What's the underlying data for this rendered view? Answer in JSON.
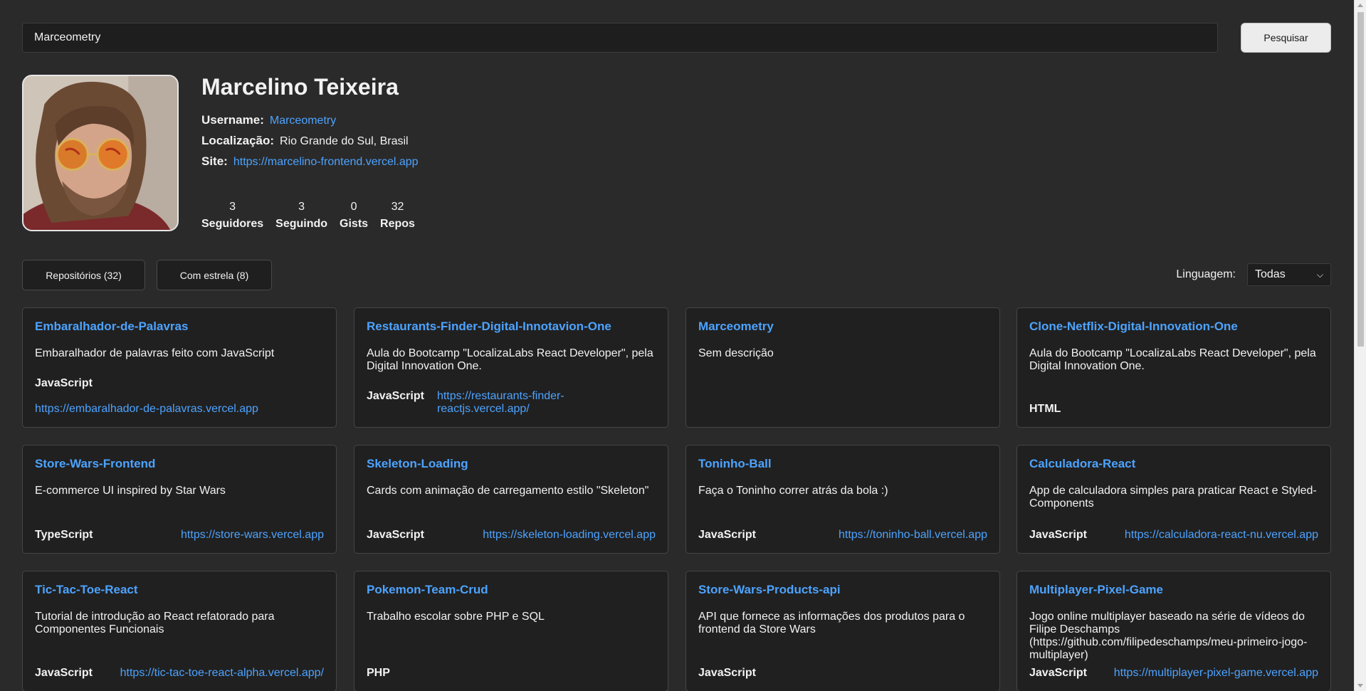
{
  "search": {
    "value": "Marceometry",
    "button_label": "Pesquisar"
  },
  "profile": {
    "name": "Marcelino Teixeira",
    "username_label": "Username:",
    "username": "Marceometry",
    "location_label": "Localização:",
    "location": "Rio Grande do Sul, Brasil",
    "site_label": "Site:",
    "site": "https://marcelino-frontend.vercel.app",
    "stats": [
      {
        "value": "3",
        "label": "Seguidores"
      },
      {
        "value": "3",
        "label": "Seguindo"
      },
      {
        "value": "0",
        "label": "Gists"
      },
      {
        "value": "32",
        "label": "Repos"
      }
    ]
  },
  "tabs": {
    "repos_label": "Repositórios (32)",
    "starred_label": "Com estrela (8)"
  },
  "filter": {
    "label": "Linguagem:",
    "selected": "Todas"
  },
  "repos": [
    {
      "title": "Embaralhador-de-Palavras",
      "desc": "Embaralhador de palavras feito com JavaScript",
      "lang": "JavaScript",
      "link": "https://embaralhador-de-palavras.vercel.app"
    },
    {
      "title": "Restaurants-Finder-Digital-Innotavion-One",
      "desc": "Aula do Bootcamp \"LocalizaLabs React Developer\", pela Digital Innovation One.",
      "lang": "JavaScript",
      "link": "https://restaurants-finder-reactjs.vercel.app/"
    },
    {
      "title": "Marceometry",
      "desc": "Sem descrição",
      "lang": "",
      "link": ""
    },
    {
      "title": "Clone-Netflix-Digital-Innovation-One",
      "desc": "Aula do Bootcamp \"LocalizaLabs React Developer\", pela Digital Innovation One.",
      "lang": "HTML",
      "link": ""
    },
    {
      "title": "Store-Wars-Frontend",
      "desc": "E-commerce UI inspired by Star Wars",
      "lang": "TypeScript",
      "link": "https://store-wars.vercel.app"
    },
    {
      "title": "Skeleton-Loading",
      "desc": "Cards com animação de carregamento estilo \"Skeleton\"",
      "lang": "JavaScript",
      "link": "https://skeleton-loading.vercel.app"
    },
    {
      "title": "Toninho-Ball",
      "desc": "Faça o Toninho correr atrás da bola :)",
      "lang": "JavaScript",
      "link": "https://toninho-ball.vercel.app"
    },
    {
      "title": "Calculadora-React",
      "desc": "App de calculadora simples para praticar React e Styled-Components",
      "lang": "JavaScript",
      "link": "https://calculadora-react-nu.vercel.app"
    },
    {
      "title": "Tic-Tac-Toe-React",
      "desc": "Tutorial de introdução ao React refatorado para Componentes Funcionais",
      "lang": "JavaScript",
      "link": "https://tic-tac-toe-react-alpha.vercel.app/"
    },
    {
      "title": "Pokemon-Team-Crud",
      "desc": "Trabalho escolar sobre PHP e SQL",
      "lang": "PHP",
      "link": ""
    },
    {
      "title": "Store-Wars-Products-api",
      "desc": "API que fornece as informações dos produtos para o frontend da Store Wars",
      "lang": "JavaScript",
      "link": ""
    },
    {
      "title": "Multiplayer-Pixel-Game",
      "desc": "Jogo online multiplayer baseado na série de vídeos do Filipe Deschamps (https://github.com/filipedeschamps/meu-primeiro-jogo-multiplayer)",
      "lang": "JavaScript",
      "link": "https://multiplayer-pixel-game.vercel.app"
    }
  ]
}
